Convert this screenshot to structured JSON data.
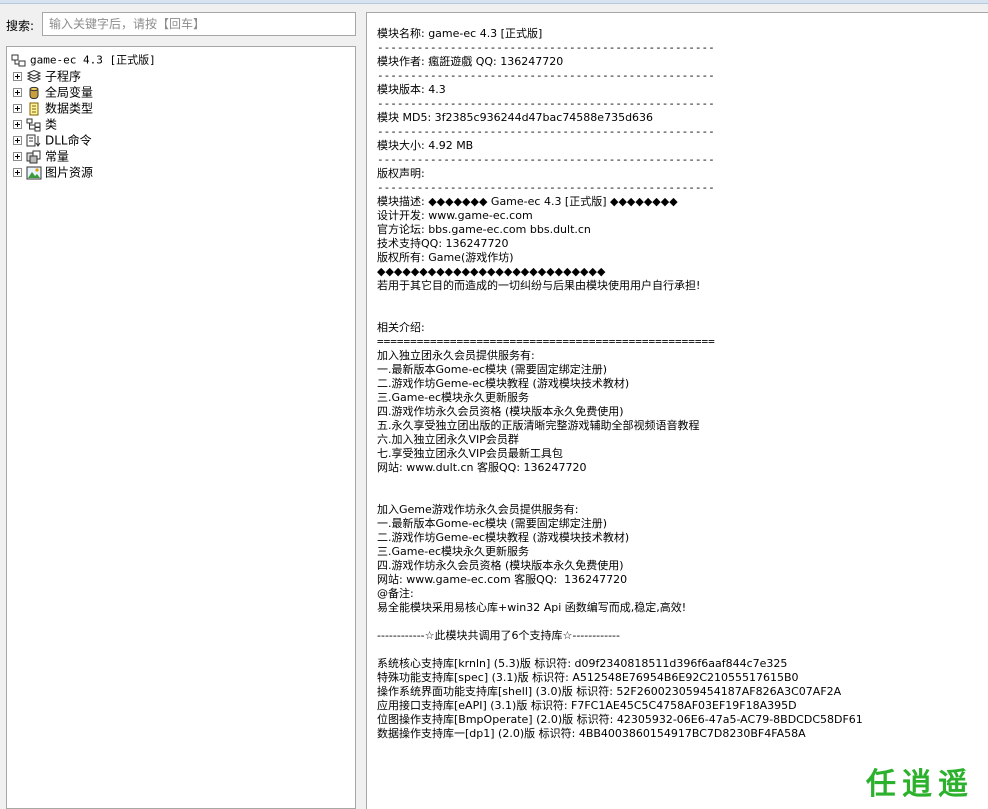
{
  "search": {
    "label": "搜索:",
    "placeholder": "输入关键字后，请按【回车】"
  },
  "tree": {
    "root_label": "game-ec 4.3 [正式版]",
    "items": [
      {
        "label": "子程序",
        "icon": "subroutine-icon"
      },
      {
        "label": "全局变量",
        "icon": "database-icon"
      },
      {
        "label": "数据类型",
        "icon": "data-type-icon"
      },
      {
        "label": "类",
        "icon": "class-icon"
      },
      {
        "label": "DLL命令",
        "icon": "dll-icon"
      },
      {
        "label": "常量",
        "icon": "constant-icon"
      },
      {
        "label": "图片资源",
        "icon": "image-resource-icon"
      }
    ]
  },
  "info": {
    "name": "模块名称: game-ec 4.3 [正式版]",
    "author": "模块作者: 瘋誑遊戲 QQ: 136247720",
    "version": "模块版本: 4.3",
    "md5": "模块 MD5: 3f2385c936244d47bac74588e735d636",
    "size": "模块大小: 4.92 MB",
    "copyright": "版权声明:",
    "separator": "---------------------------------------------------"
  },
  "description": [
    "模块描述: ◆◆◆◆◆◆◆ Game-ec 4.3 [正式版] ◆◆◆◆◆◆◆◆",
    "设计开发: www.game-ec.com",
    "官方论坛: bbs.game-ec.com bbs.dult.cn",
    "技术支持QQ: 136247720",
    "版权所有: Game(游戏作坊)",
    "◆◆◆◆◆◆◆◆◆◆◆◆◆◆◆◆◆◆◆◆◆◆◆◆◆◆◆",
    "若用于其它目的而造成的一切纠纷与后果由模块使用用户自行承担!"
  ],
  "intro": {
    "title": "相关介绍:",
    "rule": "==================================================="
  },
  "service1": [
    "加入独立团永久会员提供服务有:",
    "一.最新版本Gome-ec模块 (需要固定绑定注册)",
    "二.游戏作坊Geme-ec模块教程 (游戏模块技术教材)",
    "三.Game-ec模块永久更新服务",
    "四.游戏作坊永久会员资格 (模块版本永久免费使用)",
    "五.永久享受独立团出版的正版清晰完整游戏辅助全部视频语音教程",
    "六.加入独立团永久VIP会员群",
    "七.享受独立团永久VIP会员最新工具包",
    "网站: www.dult.cn 客服QQ: 136247720"
  ],
  "service2": [
    "加入Geme游戏作坊永久会员提供服务有:",
    "一.最新版本Gome-ec模块 (需要固定绑定注册)",
    "二.游戏作坊Geme-ec模块教程 (游戏模块技术教材)",
    "三.Game-ec模块永久更新服务",
    "四.游戏作坊永久会员资格 (模块版本永久免费使用)",
    "网站: www.game-ec.com 客服QQ:  136247720",
    "@备注:",
    "易全能模块采用易核心库+win32 Api 函数编写而成,稳定,高效!"
  ],
  "libraries": {
    "header": "------------☆此模块共调用了6个支持库☆------------",
    "items": [
      "系统核心支持库[krnln] (5.3)版 标识符: d09f2340818511d396f6aaf844c7e325",
      "特殊功能支持库[spec] (3.1)版 标识符: A512548E76954B6E92C21055517615B0",
      "操作系统界面功能支持库[shell] (3.0)版 标识符: 52F260023059454187AF826A3C07AF2A",
      "应用接口支持库[eAPI] (3.1)版 标识符: F7FC1AE45C5C4758AF03EF19F18A395D",
      "位图操作支持库[BmpOperate] (2.0)版 标识符: 42305932-06E6-47a5-AC79-8BDCDC58DF61",
      "数据操作支持库一[dp1] (2.0)版 标识符: 4BB4003860154917BC7D8230BF4FA58A"
    ]
  },
  "watermark": "任逍遥",
  "colors": {
    "watermark": "#2bb12b",
    "panel_border": "#a7a7a7"
  }
}
